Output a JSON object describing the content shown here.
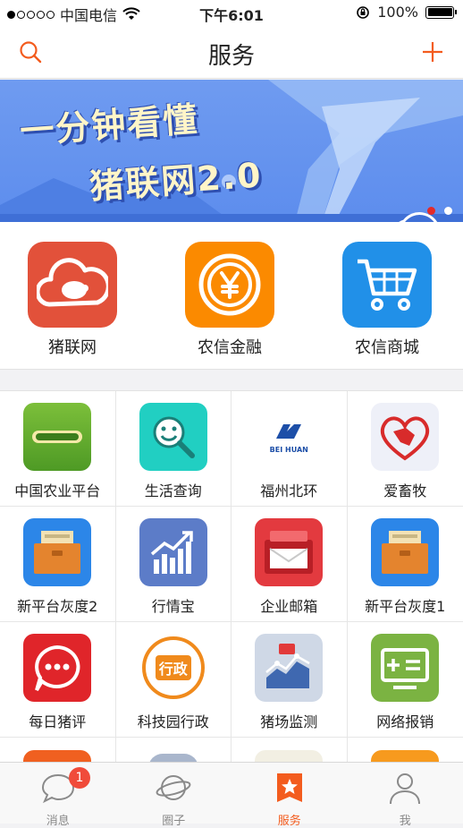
{
  "status": {
    "carrier": "中国电信",
    "time": "下午6:01",
    "battery": "100%"
  },
  "nav": {
    "title": "服务"
  },
  "banner": {
    "line1": "一分钟看懂",
    "line2": "猪联网2.0",
    "pages": 2,
    "current_page": 1
  },
  "big_apps": [
    {
      "label": "猪联网",
      "color": "#e2513a",
      "icon": "pig-cloud-icon"
    },
    {
      "label": "农信金融",
      "color": "#fb8a00",
      "icon": "yen-coin-icon"
    },
    {
      "label": "农信商城",
      "color": "#2190e8",
      "icon": "shopping-cart-icon"
    }
  ],
  "grid": [
    {
      "label": "中国农业平台",
      "icon": "agri-platform-icon"
    },
    {
      "label": "生活查询",
      "icon": "smile-search-icon"
    },
    {
      "label": "福州北环",
      "icon": "beihuan-logo-icon",
      "logo_text": "BEI HUAN"
    },
    {
      "label": "爱畜牧",
      "icon": "heart-cow-icon"
    },
    {
      "label": "新平台灰度2",
      "icon": "folder-box-icon"
    },
    {
      "label": "行情宝",
      "icon": "market-chart-icon"
    },
    {
      "label": "企业邮箱",
      "icon": "mailbox-icon"
    },
    {
      "label": "新平台灰度1",
      "icon": "folder-box-icon"
    },
    {
      "label": "每日猪评",
      "icon": "chat-bubble-icon"
    },
    {
      "label": "科技园行政",
      "icon": "admin-badge-icon",
      "badge_text": "行政"
    },
    {
      "label": "猪场监测",
      "icon": "monitor-chart-icon"
    },
    {
      "label": "网络报销",
      "icon": "calculator-screen-icon"
    }
  ],
  "tabs": [
    {
      "label": "消息",
      "icon": "chat-icon",
      "badge": "1"
    },
    {
      "label": "圈子",
      "icon": "planet-icon"
    },
    {
      "label": "服务",
      "icon": "star-bookmark-icon"
    },
    {
      "label": "我",
      "icon": "person-icon"
    }
  ],
  "colors": {
    "accent": "#f35c1e",
    "banner_bg": "#6f9bf0"
  }
}
